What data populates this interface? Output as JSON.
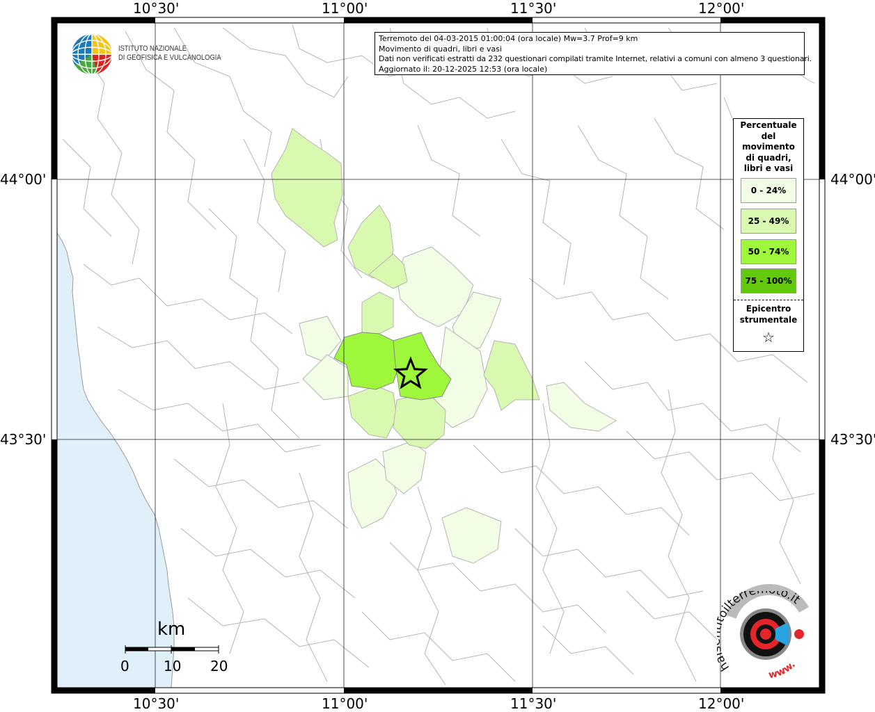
{
  "info": {
    "line1": "Terremoto del 04-03-2015 01:00:04 (ora locale) Mw=3.7 Prof=9 km",
    "line2": "Movimento di quadri, libri e vasi",
    "line3": "Dati non verificati estratti da 232 questionari compilati tramite Internet, relativi a comuni con almeno 3 questionari.",
    "line4": "Aggiornato il: 20-12-2025 12:53 (ora locale)"
  },
  "legend": {
    "title_lines": [
      "Percentuale",
      "del",
      "movimento",
      "di quadri,",
      "libri e vasi"
    ],
    "classes": [
      {
        "label": "0 - 24%",
        "color": "#f2fde6"
      },
      {
        "label": "25 - 49%",
        "color": "#d9f9b0"
      },
      {
        "label": "50 - 74%",
        "color": "#9ef73a"
      },
      {
        "label": "75 - 100%",
        "color": "#62c90c"
      }
    ],
    "epicenter_lines": [
      "Epicentro",
      "strumentale"
    ],
    "epicenter_symbol": "☆"
  },
  "axes": {
    "top": [
      "10°30'",
      "11°00'",
      "11°30'",
      "12°00'"
    ],
    "bottom": [
      "10°30'",
      "11°00'",
      "11°30'",
      "12°00'"
    ],
    "left": [
      "44°00'",
      "43°30'"
    ],
    "right": [
      "44°00'",
      "43°30'"
    ]
  },
  "logo_ingv": {
    "line1": "ISTITUTO NAZIONALE",
    "line2": "DI GEOFISICA E VULCANOLOGIA"
  },
  "logo_hsit": {
    "text_top": "haisentitoilterremoto.it",
    "text_bottom": "www."
  },
  "scale": {
    "unit": "km",
    "labels": [
      "0",
      "10",
      "20"
    ]
  },
  "colors": {
    "sea": "#dff0fb",
    "boundary": "#b4b4b4",
    "grid": "#000000"
  },
  "epicenter": {
    "lon": 11.177,
    "lat": 43.625
  }
}
